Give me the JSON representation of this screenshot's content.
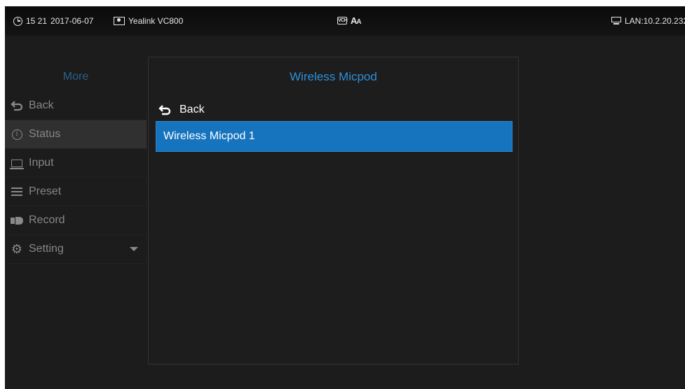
{
  "status_bar": {
    "time": "15 21",
    "date": "2017-06-07",
    "device_name": "Yealink VC800",
    "vch_icon_label": "VCH",
    "font_icon_big": "A",
    "font_icon_small": "A",
    "lan": "LAN:10.2.20.232"
  },
  "menu": {
    "title": "More",
    "items": [
      {
        "label": "Back",
        "icon": "back-arrow-icon"
      },
      {
        "label": "Status",
        "icon": "info-icon",
        "active": true
      },
      {
        "label": "Input",
        "icon": "input-icon"
      },
      {
        "label": "Preset",
        "icon": "preset-icon"
      },
      {
        "label": "Record",
        "icon": "record-icon"
      },
      {
        "label": "Setting",
        "icon": "gear-icon",
        "expandable": true
      }
    ]
  },
  "panel": {
    "title": "Wireless Micpod",
    "back_label": "Back",
    "items": [
      {
        "label": "Wireless Micpod 1",
        "selected": true
      }
    ]
  },
  "colors": {
    "accent_blue": "#1673bd",
    "title_blue": "#2f8fd8",
    "menu_title_blue": "#2b5f8a",
    "background": "#1c1c1c"
  }
}
